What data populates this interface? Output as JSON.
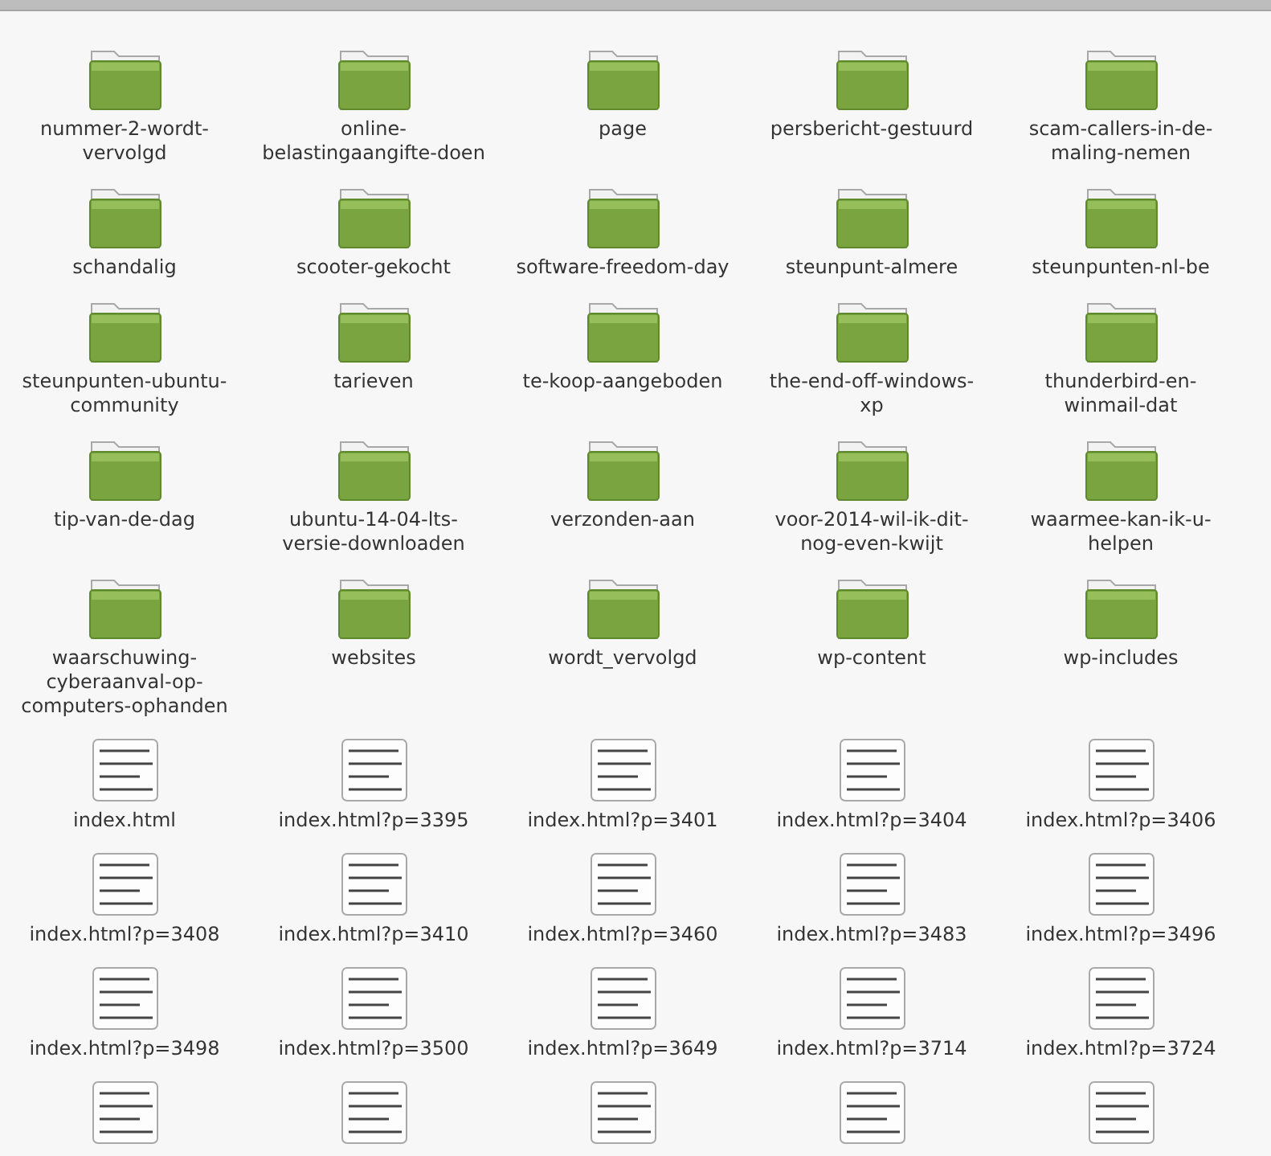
{
  "items": [
    {
      "kind": "folder",
      "name": "nummer-2-wordt-vervolgd"
    },
    {
      "kind": "folder",
      "name": "online-belastingaangifte-doen"
    },
    {
      "kind": "folder",
      "name": "page"
    },
    {
      "kind": "folder",
      "name": "persbericht-gestuurd"
    },
    {
      "kind": "folder",
      "name": "scam-callers-in-de-maling-nemen"
    },
    {
      "kind": "folder",
      "name": "schandalig"
    },
    {
      "kind": "folder",
      "name": "scooter-gekocht"
    },
    {
      "kind": "folder",
      "name": "software-freedom-day"
    },
    {
      "kind": "folder",
      "name": "steunpunt-almere"
    },
    {
      "kind": "folder",
      "name": "steunpunten-nl-be"
    },
    {
      "kind": "folder",
      "name": "steunpunten-ubuntu-community"
    },
    {
      "kind": "folder",
      "name": "tarieven"
    },
    {
      "kind": "folder",
      "name": "te-koop-aangeboden"
    },
    {
      "kind": "folder",
      "name": "the-end-off-windows-xp"
    },
    {
      "kind": "folder",
      "name": "thunderbird-en-winmail-dat"
    },
    {
      "kind": "folder",
      "name": "tip-van-de-dag"
    },
    {
      "kind": "folder",
      "name": "ubuntu-14-04-lts-versie-downloaden"
    },
    {
      "kind": "folder",
      "name": "verzonden-aan"
    },
    {
      "kind": "folder",
      "name": "voor-2014-wil-ik-dit-nog-even-kwijt"
    },
    {
      "kind": "folder",
      "name": "waarmee-kan-ik-u-helpen"
    },
    {
      "kind": "folder",
      "name": "waarschuwing-cyberaanval-op-computers-ophanden"
    },
    {
      "kind": "folder",
      "name": "websites"
    },
    {
      "kind": "folder",
      "name": "wordt_vervolgd"
    },
    {
      "kind": "folder",
      "name": "wp-content"
    },
    {
      "kind": "folder",
      "name": "wp-includes"
    },
    {
      "kind": "file",
      "name": "index.html"
    },
    {
      "kind": "file",
      "name": "index.html?p=3395"
    },
    {
      "kind": "file",
      "name": "index.html?p=3401"
    },
    {
      "kind": "file",
      "name": "index.html?p=3404"
    },
    {
      "kind": "file",
      "name": "index.html?p=3406"
    },
    {
      "kind": "file",
      "name": "index.html?p=3408"
    },
    {
      "kind": "file",
      "name": "index.html?p=3410"
    },
    {
      "kind": "file",
      "name": "index.html?p=3460"
    },
    {
      "kind": "file",
      "name": "index.html?p=3483"
    },
    {
      "kind": "file",
      "name": "index.html?p=3496"
    },
    {
      "kind": "file",
      "name": "index.html?p=3498"
    },
    {
      "kind": "file",
      "name": "index.html?p=3500"
    },
    {
      "kind": "file",
      "name": "index.html?p=3649"
    },
    {
      "kind": "file",
      "name": "index.html?p=3714"
    },
    {
      "kind": "file",
      "name": "index.html?p=3724"
    },
    {
      "kind": "file"
    },
    {
      "kind": "file"
    },
    {
      "kind": "file"
    },
    {
      "kind": "file"
    },
    {
      "kind": "file"
    }
  ]
}
